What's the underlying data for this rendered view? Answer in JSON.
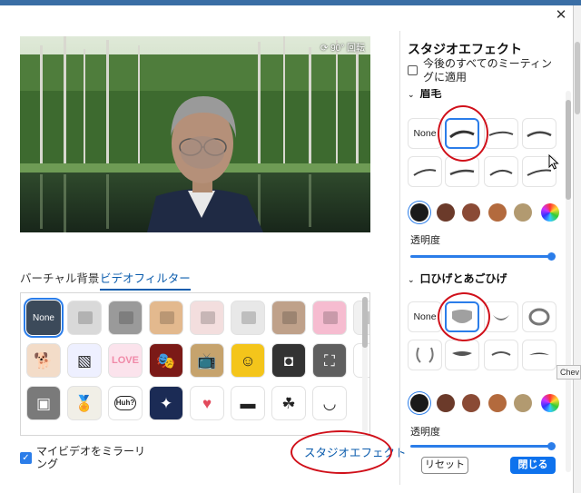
{
  "window": {
    "close_glyph": "✕"
  },
  "preview": {
    "rotate_label": "⟳ 90° 回転"
  },
  "tabs": {
    "virtual_bg": "バーチャル背景",
    "video_filter": "ビデオフィルター"
  },
  "filters": [
    {
      "label": "None",
      "bg": "#3c4a5a",
      "icon": "none-text"
    },
    {
      "label": "",
      "bg": "#d9d9d9",
      "icon": "preview-mini"
    },
    {
      "label": "",
      "bg": "#9a9a9a",
      "icon": "preview-mini"
    },
    {
      "label": "",
      "bg": "#e3b98e",
      "icon": "preview-mini"
    },
    {
      "label": "",
      "bg": "#f3dede",
      "icon": "preview-mini"
    },
    {
      "label": "",
      "bg": "#e8e8e8",
      "icon": "preview-mini"
    },
    {
      "label": "",
      "bg": "#bfa18a",
      "icon": "preview-mini"
    },
    {
      "label": "",
      "bg": "#f6bcd0",
      "icon": "preview-mini"
    },
    {
      "label": "",
      "bg": "#f1f1f1",
      "icon": "preview-mini"
    },
    {
      "label": "",
      "bg": "#f3dcc8",
      "icon": "corgi-frame-icon",
      "sym": "🐕"
    },
    {
      "label": "",
      "bg": "#eef0ff",
      "icon": "sticky-note-icon",
      "sym": "▧"
    },
    {
      "label": "LOVE",
      "bg": "#fbe3ec",
      "icon": "love-text-frame"
    },
    {
      "label": "",
      "bg": "#7b1a17",
      "icon": "theater-curtain-icon",
      "sym": "🎭"
    },
    {
      "label": "",
      "bg": "#c6a36d",
      "icon": "retro-tv-frame-icon",
      "sym": "📺"
    },
    {
      "label": "",
      "bg": "#f4c51b",
      "icon": "sunflower-frame-icon",
      "sym": "☺"
    },
    {
      "label": "",
      "bg": "#333333",
      "icon": "film-frame-icon",
      "sym": "◘"
    },
    {
      "label": "",
      "bg": "#5f5f5f",
      "icon": "camera-focus-frame-icon",
      "sym": "⛶"
    },
    {
      "label": "",
      "bg": "#ffffff",
      "icon": "blank-icon"
    },
    {
      "label": "",
      "bg": "#7a7a7a",
      "icon": "old-tv-icon",
      "sym": "▣"
    },
    {
      "label": "",
      "bg": "#f1efe7",
      "icon": "medal-ribbon-icon",
      "sym": "🏅"
    },
    {
      "label": "Huh?",
      "bg": "#ffffff",
      "icon": "speech-bubble-icon"
    },
    {
      "label": "",
      "bg": "#1b2b55",
      "icon": "string-lights-icon",
      "sym": "✦"
    },
    {
      "label": "",
      "bg": "#ffffff",
      "icon": "heart-frame-icon",
      "sym": "♥"
    },
    {
      "label": "",
      "bg": "#ffffff",
      "icon": "sunglasses-icon",
      "sym": "▬"
    },
    {
      "label": "",
      "bg": "#ffffff",
      "icon": "sprout-face-icon",
      "sym": "☘"
    },
    {
      "label": "",
      "bg": "#ffffff",
      "icon": "bowl-icon",
      "sym": "◡"
    }
  ],
  "mirror": {
    "label": "マイビデオをミラーリング",
    "checked": true
  },
  "studio_link": "スタジオエフェクト",
  "panel": {
    "title": "スタジオエフェクト",
    "apply_all": "今後のすべてのミーティングに適用",
    "eyebrows_section": "眉毛",
    "eyebrow_none": "None",
    "eyebrow_colors": [
      "#1a1a1a",
      "#6b3a2a",
      "#8a4a35",
      "#b36a3d",
      "#b29a70"
    ],
    "opacity_label": "透明度",
    "opacity_value_1": 1.0,
    "beard_section": "口ひげとあごひげ",
    "beard_none": "None",
    "beard_colors": [
      "#1a1a1a",
      "#6b3a2a",
      "#8a4a35",
      "#b36a3d",
      "#b29a70"
    ],
    "opacity_label_2": "透明度",
    "opacity_value_2": 1.0,
    "reset": "リセット",
    "close": "閉じる",
    "tooltip": "Chev"
  }
}
